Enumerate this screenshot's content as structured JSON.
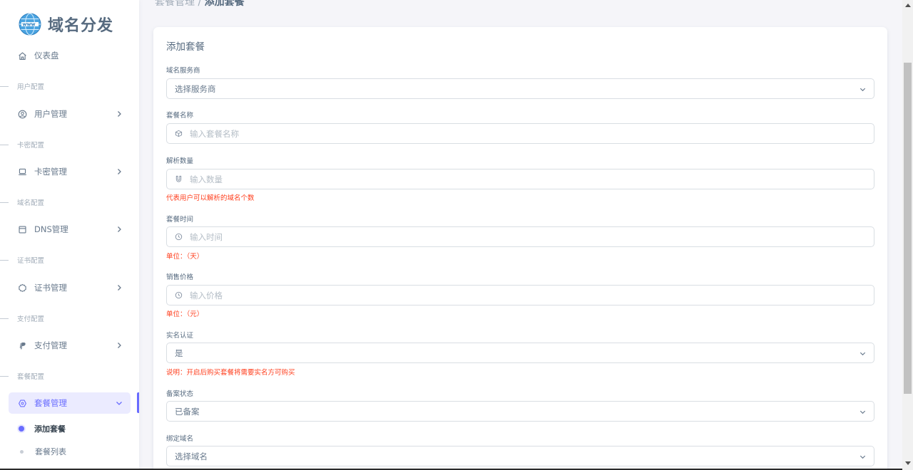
{
  "app": {
    "title": "域名分发"
  },
  "breadcrumb": {
    "parent": "套餐管理",
    "separator": "/",
    "current": "添加套餐"
  },
  "sidebar": {
    "dashboard": {
      "label": "仪表盘",
      "icon": "home-icon"
    },
    "sections": [
      {
        "header": "用户配置",
        "label": "用户管理",
        "icon": "user-circle-icon"
      },
      {
        "header": "卡密配置",
        "label": "卡密管理",
        "icon": "laptop-icon"
      },
      {
        "header": "域名配置",
        "label": "DNS管理",
        "icon": "window-icon"
      },
      {
        "header": "证书配置",
        "label": "证书管理",
        "icon": "badge-icon"
      },
      {
        "header": "支付配置",
        "label": "支付管理",
        "icon": "paypal-icon"
      },
      {
        "header": "套餐配置",
        "label": "套餐管理",
        "icon": "hexagon-icon"
      }
    ],
    "sub_items": [
      {
        "label": "添加套餐",
        "active": true
      },
      {
        "label": "套餐列表",
        "active": false
      }
    ],
    "accent_color": "#696cff"
  },
  "form": {
    "title": "添加套餐",
    "fields": [
      {
        "label": "域名服务商",
        "type": "select",
        "value": "选择服务商"
      },
      {
        "label": "套餐名称",
        "type": "input",
        "placeholder": "输入套餐名称",
        "icon": "cube-icon"
      },
      {
        "label": "解析数量",
        "type": "input",
        "placeholder": "输入数量",
        "icon": "magnet-icon",
        "hint": "代表用户可以解析的域名个数"
      },
      {
        "label": "套餐时间",
        "type": "input",
        "placeholder": "输入时间",
        "icon": "clock-icon",
        "hint": "单位：（天）"
      },
      {
        "label": "销售价格",
        "type": "input",
        "placeholder": "输入价格",
        "icon": "clock-icon",
        "hint": "单位：（元）"
      },
      {
        "label": "实名认证",
        "type": "select",
        "value": "是",
        "hint": "说明：开启后购买套餐将需要实名方可购买"
      },
      {
        "label": "备案状态",
        "type": "select",
        "value": "已备案"
      },
      {
        "label": "绑定域名",
        "type": "select",
        "value": "选择域名"
      }
    ],
    "hint_color": "#ff3e1d"
  }
}
